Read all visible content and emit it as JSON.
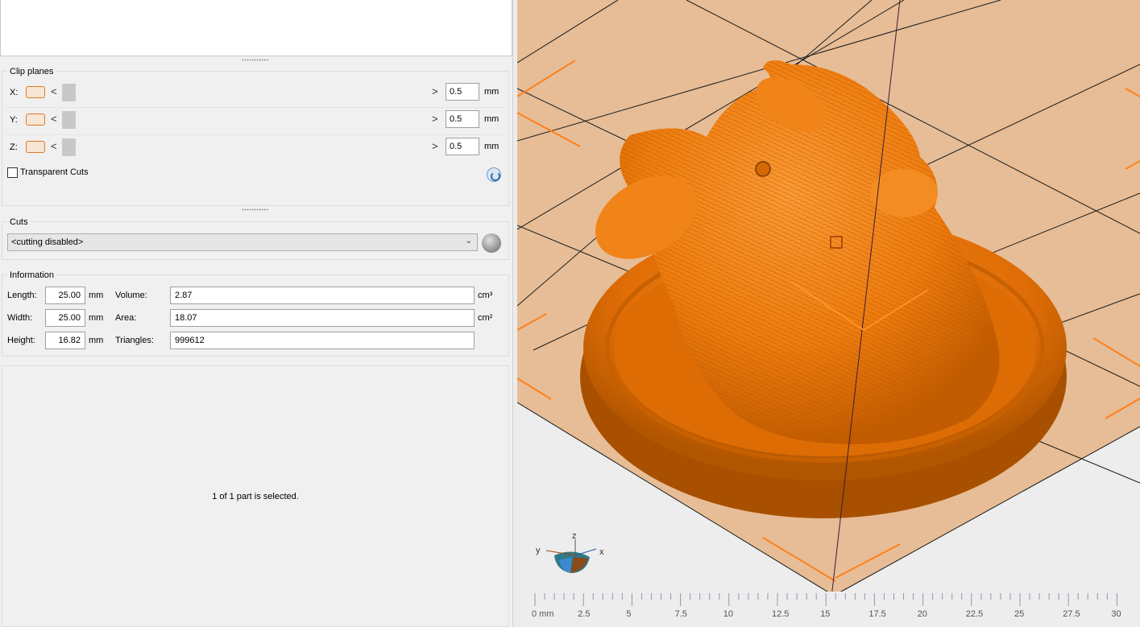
{
  "clip_planes": {
    "title": "Clip planes",
    "axes": [
      {
        "label": "X:",
        "value": "0.5",
        "unit": "mm"
      },
      {
        "label": "Y:",
        "value": "0.5",
        "unit": "mm"
      },
      {
        "label": "Z:",
        "value": "0.5",
        "unit": "mm"
      }
    ],
    "left_arrow": "<",
    "right_arrow": ">",
    "transparent_cuts_label": "Transparent Cuts"
  },
  "cuts": {
    "title": "Cuts",
    "selected": "<cutting disabled>"
  },
  "information": {
    "title": "Information",
    "length_label": "Length:",
    "length_value": "25.00",
    "length_unit": "mm",
    "width_label": "Width:",
    "width_value": "25.00",
    "width_unit": "mm",
    "height_label": "Height:",
    "height_value": "16.82",
    "height_unit": "mm",
    "volume_label": "Volume:",
    "volume_value": "2.87",
    "volume_unit": "cm³",
    "area_label": "Area:",
    "area_value": "18.07",
    "area_unit": "cm²",
    "triangles_label": "Triangles:",
    "triangles_value": "999612"
  },
  "selection_status": "1 of 1 part is selected.",
  "viewport": {
    "axis_labels": {
      "x": "x",
      "y": "y",
      "z": "z"
    },
    "ruler_labels": [
      "0 mm",
      "2.5",
      "5",
      "7.5",
      "10",
      "12.5",
      "15",
      "17.5",
      "20",
      "22.5",
      "25",
      "27.5",
      "30"
    ],
    "colors": {
      "model": "#f07d10",
      "platform": "#e6bd96",
      "grid": "#1a1a1a",
      "accent": "#ff8a1f"
    }
  }
}
